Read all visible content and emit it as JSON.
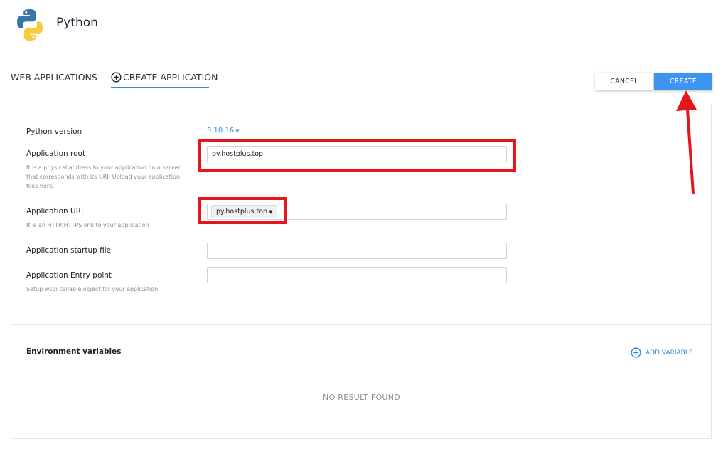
{
  "header": {
    "title": "Python",
    "logo_icon": "python-logo-icon"
  },
  "tabs": [
    {
      "label": "WEB APPLICATIONS"
    },
    {
      "label": "CREATE APPLICATION",
      "icon": "plus-circle-icon",
      "active": true
    }
  ],
  "actions": {
    "cancel_label": "CANCEL",
    "create_label": "CREATE"
  },
  "form": {
    "python_version": {
      "label": "Python version",
      "value": "3.10.16"
    },
    "app_root": {
      "label": "Application root",
      "help": "It is a physical address to your application on a server that corresponds with its URI. Upload your application files here.",
      "value": "py.hostplus.top"
    },
    "app_url": {
      "label": "Application URL",
      "help": "It is an HTTP/HTTPS link to your application",
      "domain": "py.hostplus.top",
      "path": ""
    },
    "startup_file": {
      "label": "Application startup file",
      "value": ""
    },
    "entry_point": {
      "label": "Application Entry point",
      "help": "Setup wsgi callable object for your application",
      "value": ""
    }
  },
  "env": {
    "title": "Environment variables",
    "add_label": "ADD VARIABLE",
    "add_icon": "plus-circle-icon",
    "empty_text": "NO RESULT FOUND"
  },
  "colors": {
    "accent": "#3d95f0",
    "link": "#2b8be0",
    "annotation": "#e3171b"
  }
}
